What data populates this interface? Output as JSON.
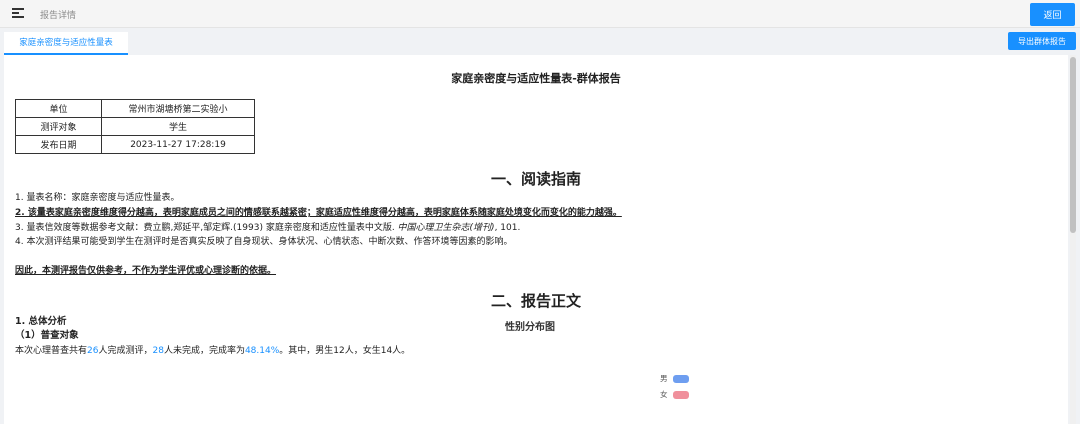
{
  "header": {
    "breadcrumb": "报告详情",
    "back_label": "返回"
  },
  "tabs": {
    "active_label": "家庭亲密度与适应性量表",
    "export_label": "导出群体报告"
  },
  "report": {
    "title": "家庭亲密度与适应性量表-群体报告",
    "meta": [
      {
        "key": "单位",
        "value": "常州市湖塘桥第二实验小"
      },
      {
        "key": "测评对象",
        "value": "学生"
      },
      {
        "key": "发布日期",
        "value": "2023-11-27 17:28:19"
      }
    ],
    "section1_title": "一、阅读指南",
    "guide_line1": "1. 量表名称：家庭亲密度与适应性量表。",
    "guide_line2": "2. 该量表家庭亲密度维度得分越高，表明家庭成员之间的情感联系越紧密；家庭适应性维度得分越高，表明家庭体系随家庭处境变化而变化的能力越强。",
    "guide_line3_a": "3. 量表信效度等数据参考文献：费立鹏,郑延平,邹定辉.(1993) 家庭亲密度和适应性量表中文版. ",
    "guide_line3_journal": "中国心理卫生杂志(增刊)",
    "guide_line3_b": ", 101.",
    "guide_line4": "4. 本次测评结果可能受到学生在测评时是否真实反映了自身现状、身体状况、心情状态、中断次数、作答环境等因素的影响。",
    "disclaimer": "因此，本测评报告仅供参考，不作为学生评优或心理诊断的依据。",
    "section2_title": "二、报告正文",
    "analysis_title": "1. 总体分析",
    "sub_title": "（1）普查对象",
    "summary_a": "本次心理普查共有",
    "completed": "26",
    "summary_b": "人完成测评，",
    "incomplete": "28",
    "summary_c": "人未完成，完成率为",
    "rate": "48.14%",
    "summary_d": "。其中，男生12人，女生14人。",
    "chart_title": "性别分布图",
    "legend": [
      {
        "label": "男",
        "color": "#6e9ef0"
      },
      {
        "label": "女",
        "color": "#f0909c"
      }
    ]
  }
}
